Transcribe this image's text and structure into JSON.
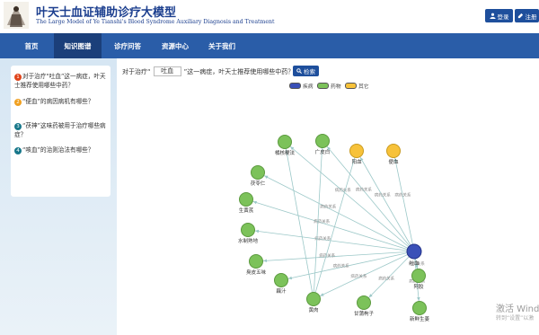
{
  "header": {
    "title_cn": "叶天士血证辅助诊疗大模型",
    "title_en": "The Large Model of Ye Tianshi's Blood Syndrome Auxiliary Diagnosis and Treatment",
    "login_label": "登录",
    "register_label": "注册"
  },
  "nav": {
    "items": [
      {
        "label": "首页"
      },
      {
        "label": "知识图谱"
      },
      {
        "label": "诊疗问答"
      },
      {
        "label": "资源中心"
      },
      {
        "label": "关于我们"
      }
    ],
    "active_index": 1
  },
  "sidebar": {
    "questions": [
      {
        "num": "1",
        "color": "#e0441b",
        "text": "对于治疗“吐血”这一病症，叶天士推荐使用哪些中药？"
      },
      {
        "num": "2",
        "color": "#f0a020",
        "text": "“便血”的病因病机有哪些？"
      },
      {
        "num": "3",
        "color": "#17778a",
        "text": "“茯神”这味药被用于治疗哪些病症？"
      },
      {
        "num": "4",
        "color": "#17778a",
        "text": "“咳血”的治则治法有哪些？"
      }
    ]
  },
  "query": {
    "prefix": "对于治疗“",
    "value": "吐血",
    "suffix": "”这一病症，叶天士推荐使用哪些中药？",
    "search_label": "检索"
  },
  "legend": [
    {
      "label": "疾病",
      "color": "#3a50b8"
    },
    {
      "label": "药物",
      "color": "#7cc25a"
    },
    {
      "label": "其它",
      "color": "#f7c23a"
    }
  ],
  "graph": {
    "center": {
      "label": "吐血"
    },
    "drugs": [
      "广皮白",
      "橘核粳法",
      "茯苓仁",
      "生黄芪",
      "水制熟地",
      "藕汁",
      "臭皮五味",
      "黄肉",
      "甘蒲枸子",
      "阿胶",
      "新鲜生姜"
    ],
    "others": [
      "阳血",
      "便血"
    ],
    "edge_label": "病药关系"
  },
  "watermark": {
    "line1": "激活 Wind",
    "line2": "转到“设置”以激"
  }
}
